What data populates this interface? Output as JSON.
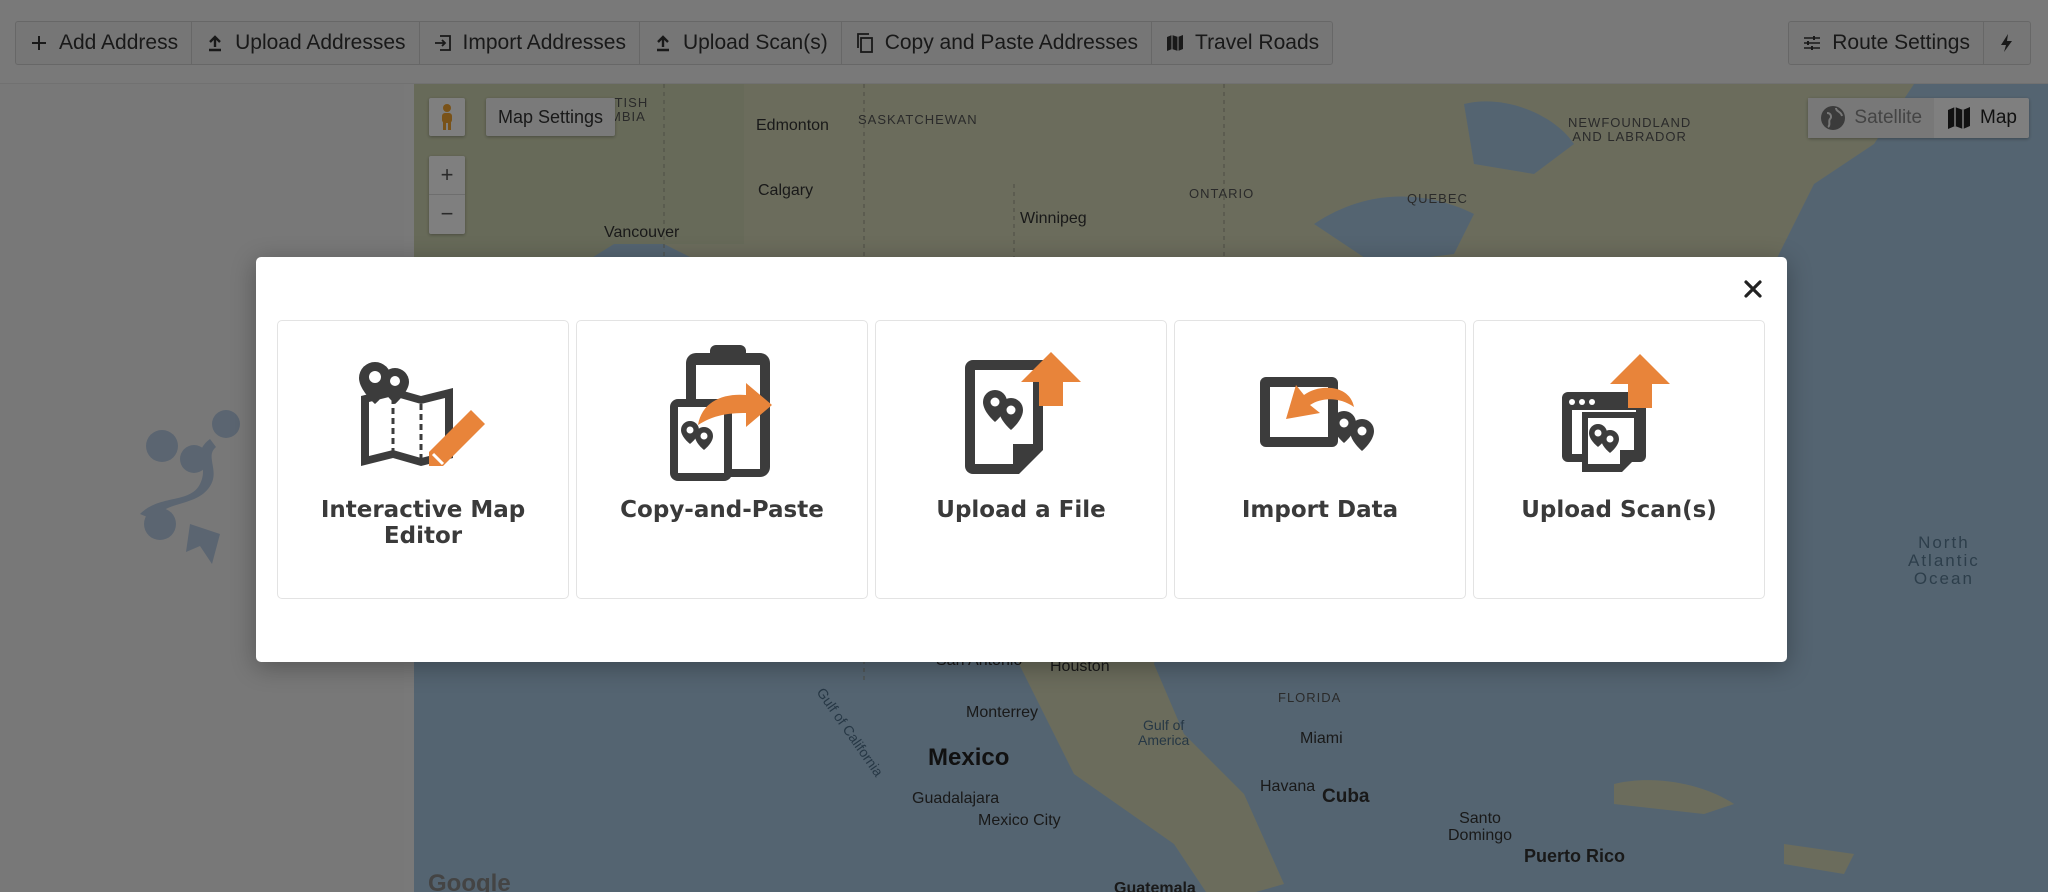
{
  "toolbar": {
    "left_buttons": [
      {
        "label": "Add Address",
        "icon": "plus-icon"
      },
      {
        "label": "Upload Addresses",
        "icon": "upload-icon"
      },
      {
        "label": "Import Addresses",
        "icon": "import-icon"
      },
      {
        "label": "Upload Scan(s)",
        "icon": "upload-icon"
      },
      {
        "label": "Copy and Paste Addresses",
        "icon": "copy-icon"
      },
      {
        "label": "Travel Roads",
        "icon": "map-icon"
      }
    ],
    "route_settings_label": "Route Settings",
    "optimize_icon": "lightning-icon"
  },
  "map": {
    "settings_label": "Map Settings",
    "zoom_in": "+",
    "zoom_out": "−",
    "type_options": [
      "Satellite",
      "Map"
    ],
    "selected_type": "Map",
    "attribution": "Google",
    "labels": {
      "bc": "ITISH\nMBIA",
      "edmonton": "Edmonton",
      "saskatchewan": "SASKATCHEWAN",
      "calgary": "Calgary",
      "vancouver": "Vancouver",
      "winnipeg": "Winnipeg",
      "ontario": "ONTARIO",
      "quebec": "QUEBEC",
      "newfoundland": "NEWFOUNDLAND\nAND LABRADOR",
      "north_atlantic": "North\nAtlantic\nOcean",
      "san_antonio": "San Antonio",
      "houston": "Houston",
      "gulf_california": "Gulf of California",
      "monterrey": "Monterrey",
      "mexico": "Mexico",
      "gulf_america": "Gulf of\nAmerica",
      "florida": "FLORIDA",
      "miami": "Miami",
      "havana": "Havana",
      "cuba": "Cuba",
      "guadalajara": "Guadalajara",
      "mexico_city": "Mexico City",
      "santo_domingo": "Santo\nDomingo",
      "puerto_rico": "Puerto Rico",
      "guatemala": "Guatemala"
    }
  },
  "modal": {
    "close_icon": "close-icon",
    "options": [
      {
        "label": "Interactive Map Editor",
        "icon": "map-editor-icon"
      },
      {
        "label": "Copy-and-Paste",
        "icon": "clipboard-paste-icon"
      },
      {
        "label": "Upload a File",
        "icon": "file-upload-icon"
      },
      {
        "label": "Import Data",
        "icon": "import-data-icon"
      },
      {
        "label": "Upload Scan(s)",
        "icon": "scan-upload-icon"
      }
    ]
  },
  "colors": {
    "accent": "#e8843a",
    "icon_dark": "#3c3c3c"
  }
}
